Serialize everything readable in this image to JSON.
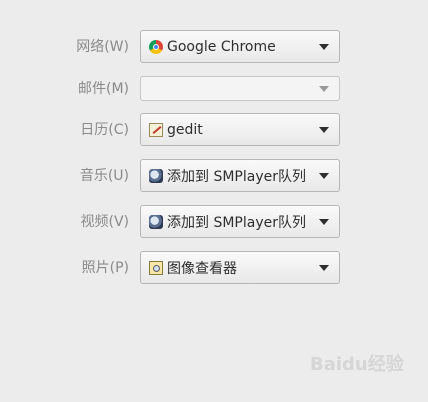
{
  "rows": [
    {
      "label": "网络(W)",
      "app": "Google Chrome",
      "icon": "chrome-icon"
    },
    {
      "label": "邮件(M)",
      "app": "",
      "icon": ""
    },
    {
      "label": "日历(C)",
      "app": "gedit",
      "icon": "gedit-icon"
    },
    {
      "label": "音乐(U)",
      "app": "添加到 SMPlayer队列",
      "icon": "smplayer-icon"
    },
    {
      "label": "视频(V)",
      "app": "添加到 SMPlayer队列",
      "icon": "smplayer-icon"
    },
    {
      "label": "照片(P)",
      "app": "图像查看器",
      "icon": "image-viewer-icon"
    }
  ],
  "watermark": {
    "text": "Baidu经验"
  }
}
